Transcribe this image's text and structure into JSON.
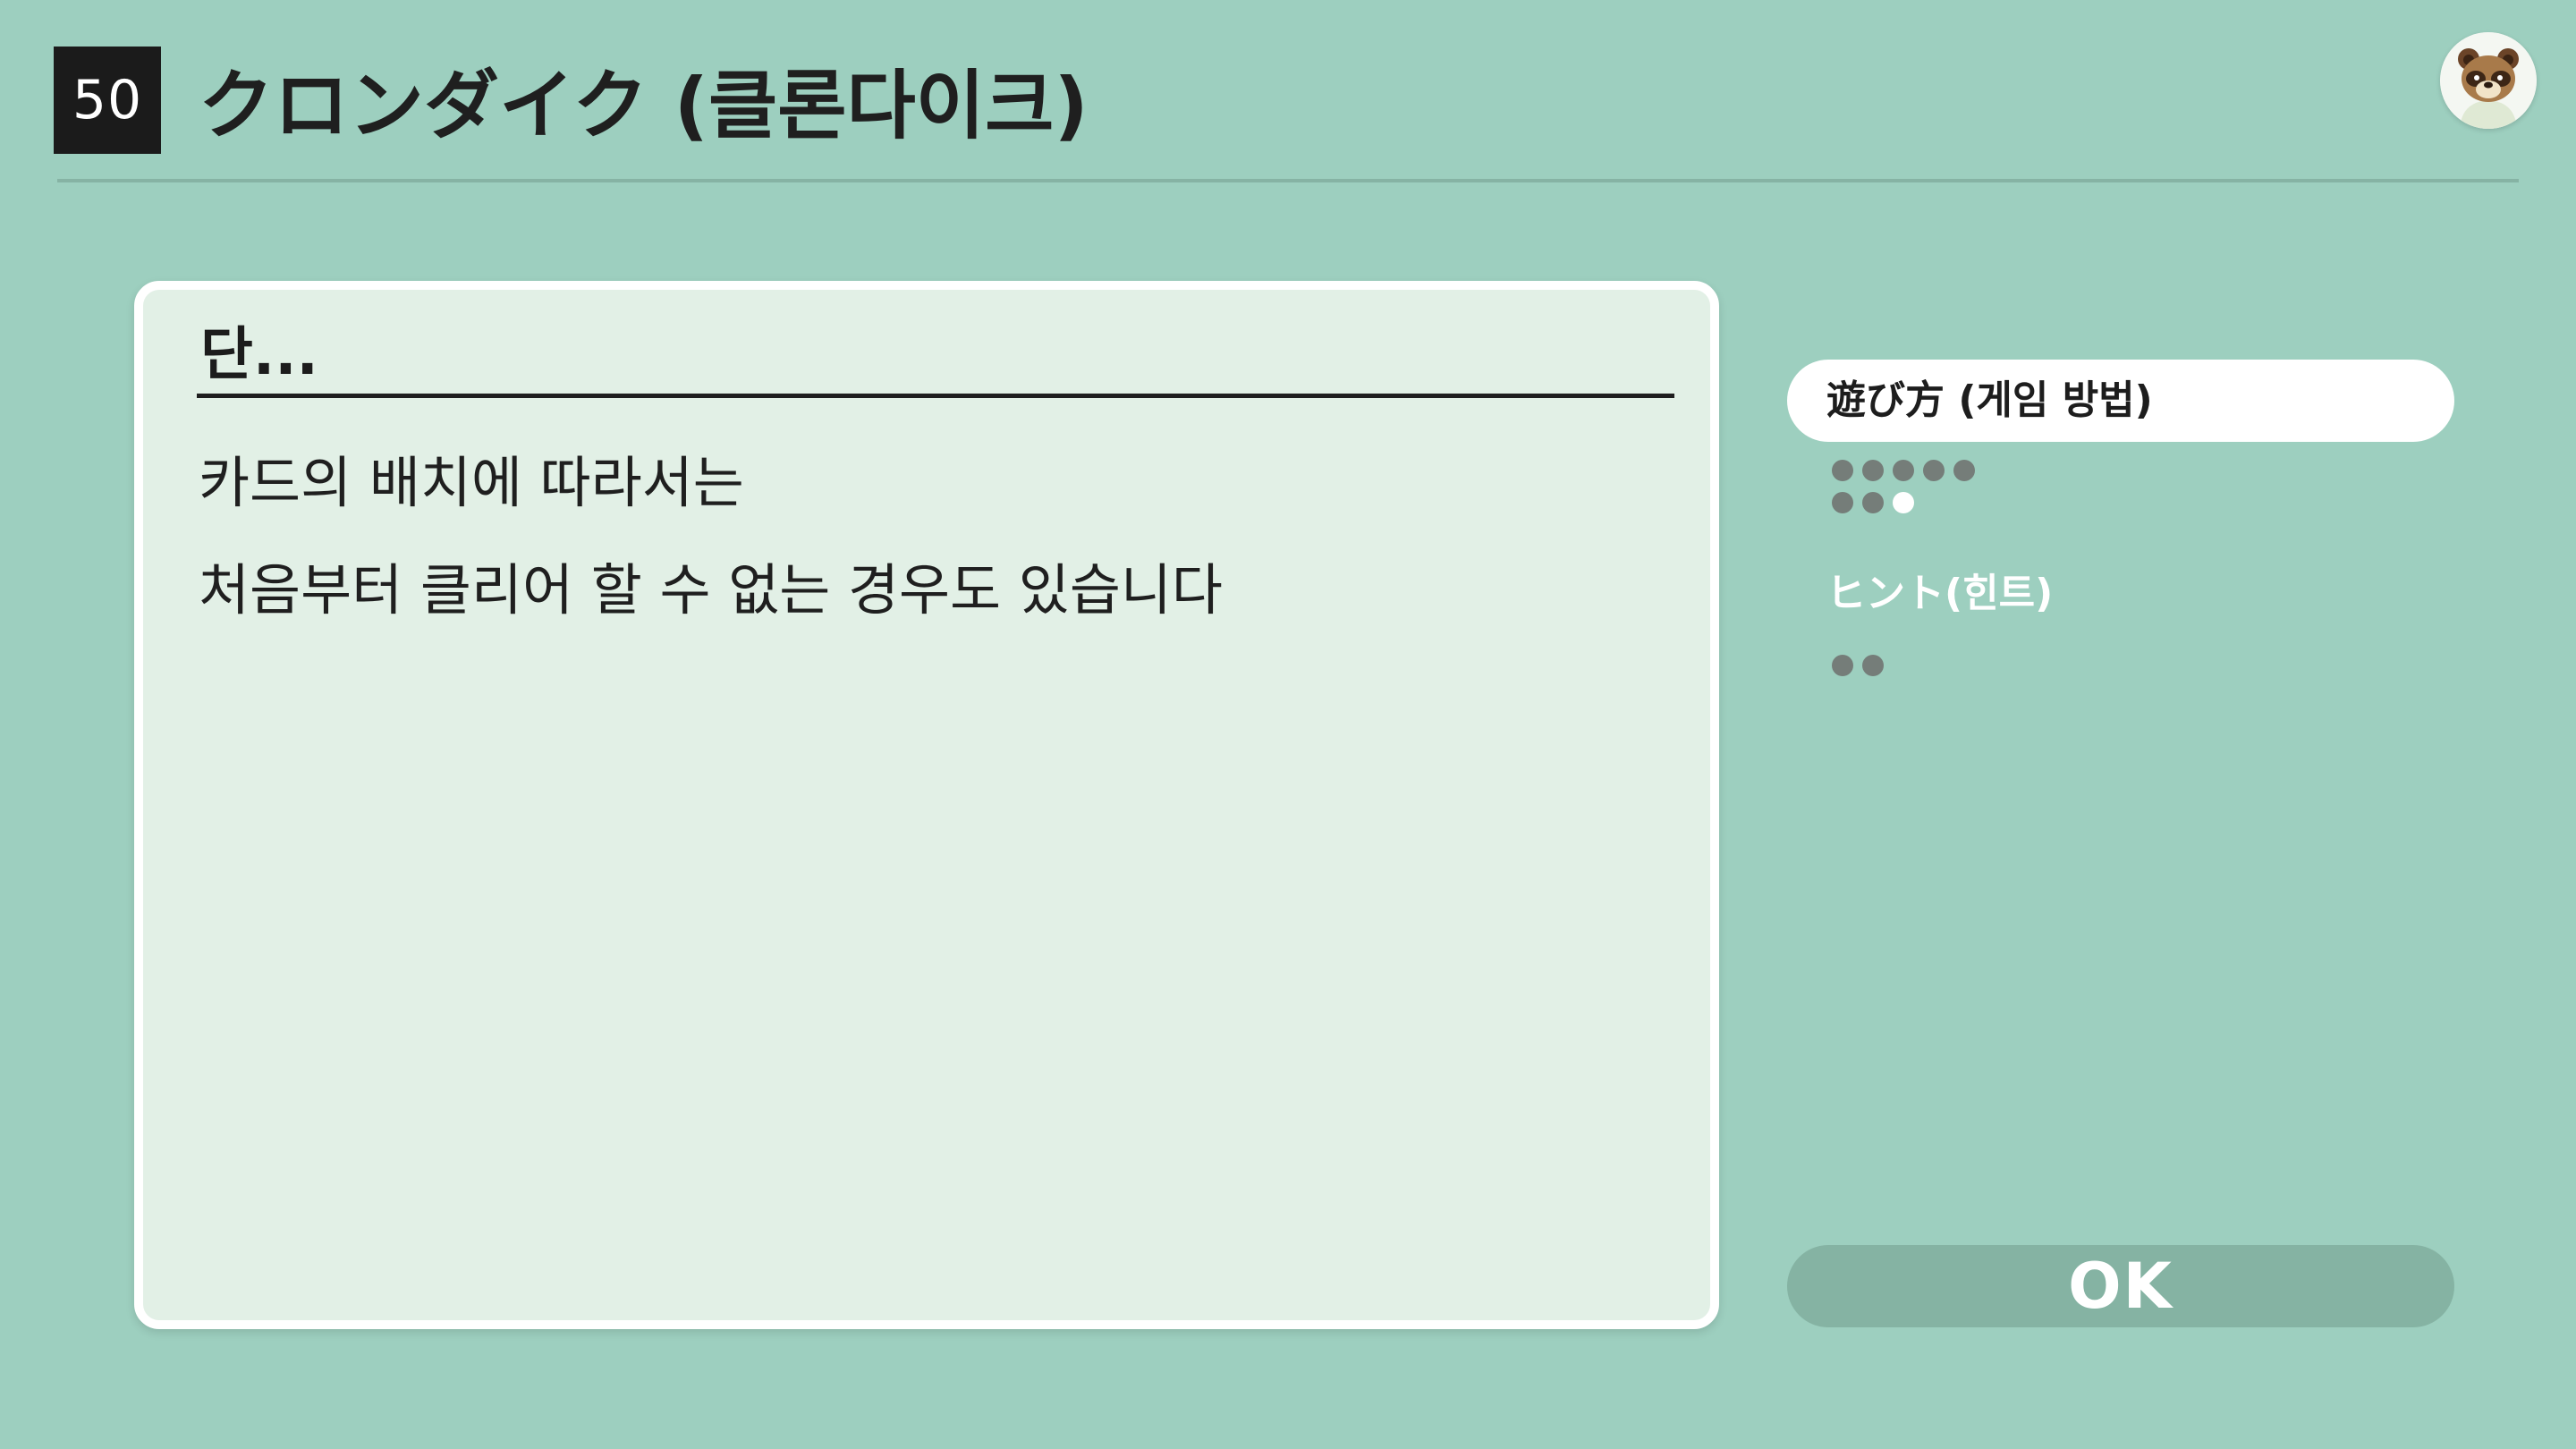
{
  "header": {
    "game_number": "50",
    "game_title": "クロンダイク (클론다이크)",
    "avatar_icon": "tom-nook-avatar-icon"
  },
  "panel": {
    "heading": "단...",
    "lines": [
      "카드의 배치에 따라서는",
      "처음부터 클리어 할 수 없는 경우도 있습니다"
    ]
  },
  "menu": {
    "items": [
      {
        "label": "遊び方 (게임 방법)",
        "selected": true,
        "pages": 8,
        "current_page": 8
      },
      {
        "label": "ヒント(힌트)",
        "selected": false,
        "pages": 2,
        "current_page": 0
      }
    ]
  },
  "ok_button": {
    "label": "OK"
  },
  "colors": {
    "background": "#9dcfbf",
    "panel": "#e2f0e6",
    "ok_button": "#85b3a3",
    "dot": "#757d79",
    "dot_current": "#ffffff"
  }
}
